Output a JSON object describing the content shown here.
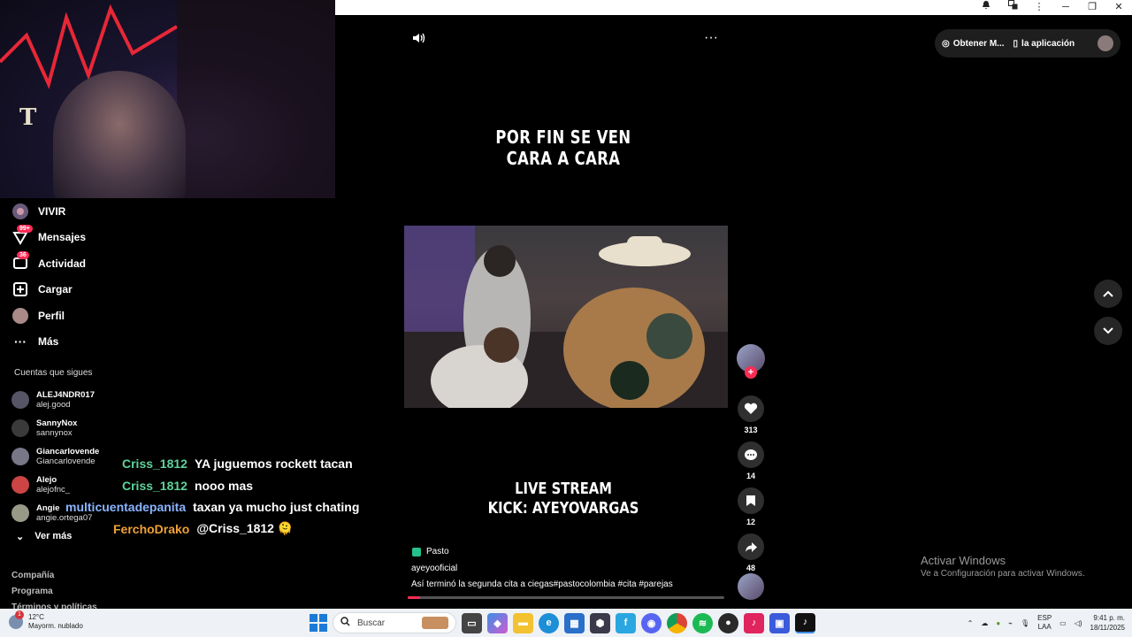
{
  "window": {
    "controls": [
      "bell",
      "translate",
      "more",
      "minimize",
      "maximize",
      "close"
    ]
  },
  "nav": {
    "items": [
      {
        "label": "VIVIR",
        "icon": "live-icon",
        "badge": ""
      },
      {
        "label": "Mensajes",
        "icon": "messages-icon",
        "badge": "99+"
      },
      {
        "label": "Actividad",
        "icon": "activity-icon",
        "badge": "36"
      },
      {
        "label": "Cargar",
        "icon": "upload-icon",
        "badge": ""
      },
      {
        "label": "Perfil",
        "icon": "profile-icon",
        "badge": ""
      },
      {
        "label": "Más",
        "icon": "more-icon",
        "badge": ""
      }
    ]
  },
  "following": {
    "title": "Cuentas que sigues",
    "accounts": [
      {
        "name": "ALEJ4NDR017",
        "handle": "alej.good"
      },
      {
        "name": "SannyNox",
        "handle": "sannynox"
      },
      {
        "name": "Giancarlovende",
        "handle": "Giancarlovende"
      },
      {
        "name": "Alejo",
        "handle": "alejofnc_"
      },
      {
        "name": "Angie",
        "handle": "angie.ortega07"
      }
    ],
    "see_more": "Ver más"
  },
  "footer_links": [
    "Compañía",
    "Programa",
    "Términos y políticas"
  ],
  "chat": [
    {
      "user": "Criss_1812",
      "color": "#5fd39a",
      "msg": "YA juguemos rockett tacan"
    },
    {
      "user": "Criss_1812",
      "color": "#5fd39a",
      "msg": "nooo mas"
    },
    {
      "user": "multicuentadepanita",
      "color": "#8ab4ff",
      "msg": "taxan ya mucho just chating"
    },
    {
      "user": "FerchoDrako",
      "color": "#f0a236",
      "msg": "@Criss_1812 🫠"
    }
  ],
  "video": {
    "title_top_1": "POR FIN SE VEN",
    "title_top_2": "CARA A CARA",
    "title_bottom_1": "LIVE STREAM",
    "title_bottom_2": "KICK: AYEYOVARGAS",
    "location": "Pasto",
    "author": "ayeyooficial",
    "caption": "Así terminó la segunda cita a ciegas#pastocolombia  #cita  #parejas",
    "progress": 0.04
  },
  "actions": {
    "likes": "313",
    "comments": "14",
    "saves": "12",
    "shares": "48"
  },
  "header": {
    "get_coins": "Obtener M...",
    "get_app": "la aplicación"
  },
  "activate_windows": {
    "line1": "Activar Windows",
    "line2": "Ve a Configuración para activar Windows."
  },
  "taskbar": {
    "weather_temp": "12°C",
    "weather_desc": "Mayorm. nublado",
    "weather_badge": "1",
    "search_placeholder": "Buscar",
    "lang_1": "ESP",
    "lang_2": "LAA",
    "time": "9:41 p. m.",
    "date": "18/11/2025"
  }
}
